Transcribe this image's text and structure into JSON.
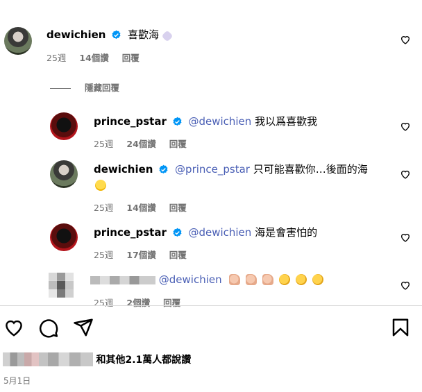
{
  "comments": [
    {
      "username": "dewichien",
      "text": "喜歡海",
      "emoji": "purple-heart",
      "time": "25週",
      "likes": "14個讚",
      "reply": "回覆"
    },
    {
      "username": "prince_pstar",
      "mention": "@dewichien",
      "text": "我以爲喜歡我",
      "time": "25週",
      "likes": "24個讚",
      "reply": "回覆"
    },
    {
      "username": "dewichien",
      "mention": "@prince_pstar",
      "text": "只可能喜歡你…後面的海",
      "emoji": "laughing-face",
      "time": "25週",
      "likes": "14個讚",
      "reply": "回覆"
    },
    {
      "username": "prince_pstar",
      "mention": "@dewichien",
      "text": "海是會害怕的",
      "time": "25週",
      "likes": "17個讚",
      "reply": "回覆"
    },
    {
      "username": "",
      "mention": "@dewichien",
      "emojis": [
        "thumbs-up",
        "thumbs-up",
        "thumbs-up",
        "clapping-hands",
        "clapping-hands",
        "clapping-hands"
      ],
      "time": "25週",
      "likes": "2個讚",
      "reply": "回覆"
    }
  ],
  "hide_replies": "隱藏回覆",
  "likes_summary": "和其他2.1萬人都說讚",
  "date": "5月1日",
  "colors": {
    "mention": "#4a5fb5",
    "verified": "#0095f6",
    "meta": "#737373"
  }
}
